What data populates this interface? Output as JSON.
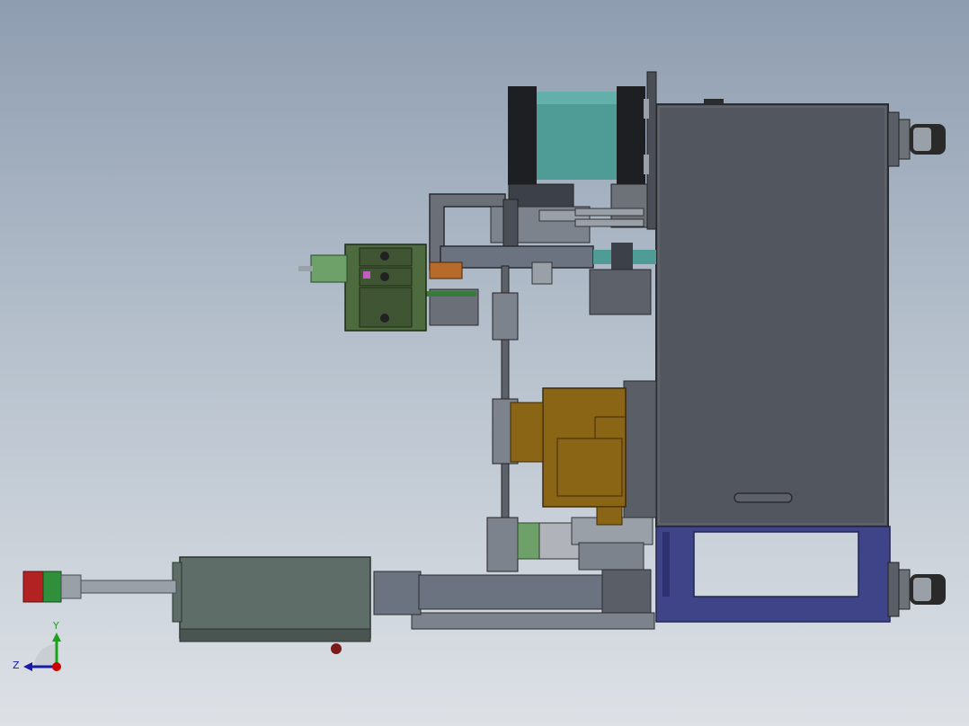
{
  "viewport": {
    "background_top": "#8e9db0",
    "background_bottom": "#dde1e6"
  },
  "model": {
    "description_icons": [
      "cad-assembly-icon"
    ],
    "colors": {
      "cabinet": "#52565f",
      "cabinet_edge": "#2a2c30",
      "frame": "#3f4488",
      "motor_green": "#5f6d68",
      "cylinder_teal": "#4f9c96",
      "brass": "#8a6516",
      "signal_red": "#b22222",
      "signal_green": "#2f8f3a",
      "pcb_green": "#4e6b3f",
      "steel": "#7d838c"
    }
  },
  "triad": {
    "y_label": "Y",
    "z_label": "Z",
    "x_color": "#cc0000",
    "y_color": "#1aa31a",
    "z_color": "#1a1aa8"
  }
}
